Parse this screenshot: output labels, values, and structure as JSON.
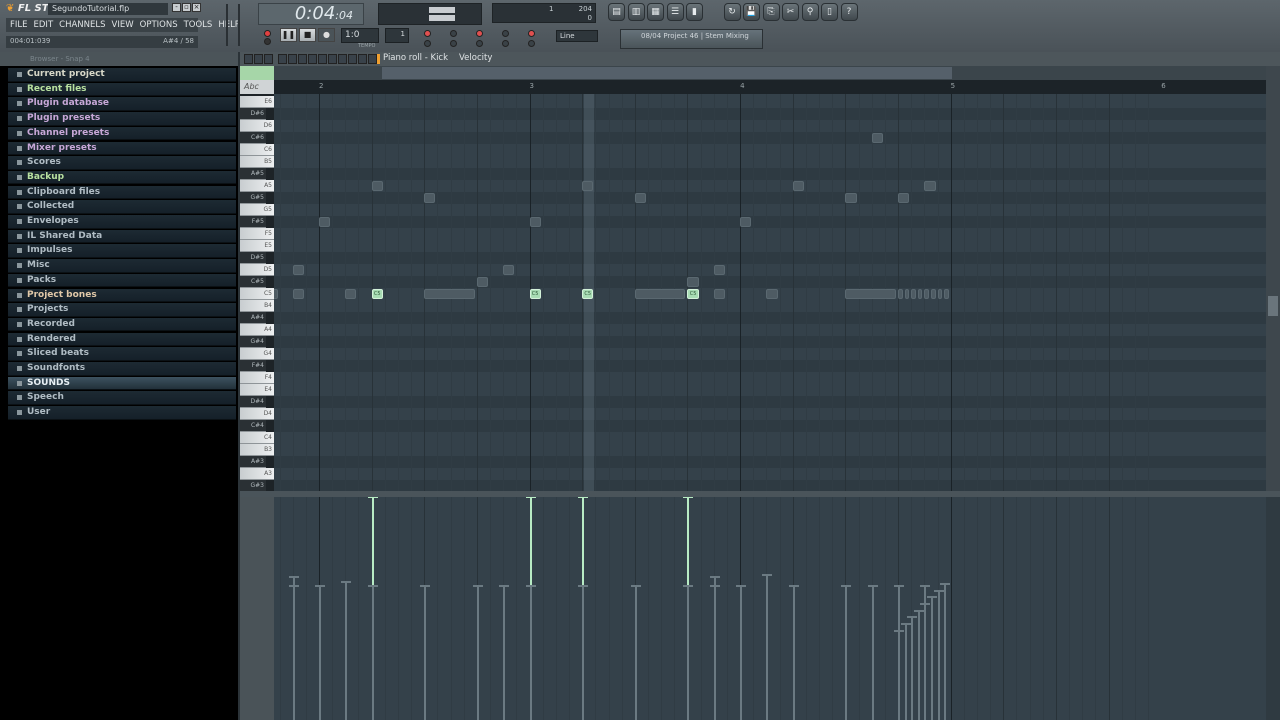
{
  "app": {
    "logo": "FL STUDIO",
    "file_name": "SegundoTutorial.flp",
    "menu": [
      "FILE",
      "EDIT",
      "CHANNELS",
      "VIEW",
      "OPTIONS",
      "TOOLS",
      "HELP"
    ],
    "hint_left": "004:01:039",
    "hint_right": "A#4 / 58"
  },
  "transport": {
    "time_main": "0:04",
    "time_sub": "04",
    "pattern": "1",
    "tempo_label": "TEMPO",
    "monitor_value": "1",
    "cpu_value": "204",
    "poly_value": "0",
    "snap": "Line",
    "project_label": "08/04 Project 46 | Stem Mixing"
  },
  "browser": {
    "header": "Browser - Snap 4",
    "items": [
      {
        "label": "Current project",
        "color": "#d8d8c8"
      },
      {
        "label": "Recent files",
        "color": "#b8e0a0"
      },
      {
        "label": "Plugin database",
        "color": "#c8a8d8"
      },
      {
        "label": "Plugin presets",
        "color": "#c8a8d8"
      },
      {
        "label": "Channel presets",
        "color": "#c8a8d8"
      },
      {
        "label": "Mixer presets",
        "color": "#c8a8d8"
      },
      {
        "label": "Scores",
        "color": "#b0bcc4"
      },
      {
        "label": "Backup",
        "color": "#b8e0a0"
      },
      {
        "label": "Clipboard files",
        "color": "#b0bcc4"
      },
      {
        "label": "Collected",
        "color": "#b0bcc4"
      },
      {
        "label": "Envelopes",
        "color": "#b0bcc4"
      },
      {
        "label": "IL Shared Data",
        "color": "#b0bcc4"
      },
      {
        "label": "Impulses",
        "color": "#b0bcc4"
      },
      {
        "label": "Misc",
        "color": "#b0bcc4"
      },
      {
        "label": "Packs",
        "color": "#b0bcc4"
      },
      {
        "label": "Project bones",
        "color": "#e0c8a8"
      },
      {
        "label": "Projects",
        "color": "#b0bcc4"
      },
      {
        "label": "Recorded",
        "color": "#b0bcc4"
      },
      {
        "label": "Rendered",
        "color": "#b0bcc4"
      },
      {
        "label": "Sliced beats",
        "color": "#b0bcc4"
      },
      {
        "label": "Soundfonts",
        "color": "#b0bcc4"
      },
      {
        "label": "SOUNDS",
        "color": "#e8f0f4",
        "active": true
      },
      {
        "label": "Speech",
        "color": "#b0bcc4"
      },
      {
        "label": "User",
        "color": "#b0bcc4"
      }
    ]
  },
  "piano_roll": {
    "title": "Piano roll - Kick",
    "target": "Velocity",
    "ruler_bars": [
      "2",
      "3",
      "4",
      "5",
      "6"
    ],
    "keys": [
      "E6",
      "D#6",
      "D6",
      "C#6",
      "C6",
      "B5",
      "A#5",
      "A5",
      "G#5",
      "G5",
      "F#5",
      "F5",
      "E5",
      "D#5",
      "D5",
      "C#5",
      "C5",
      "B4",
      "A#4",
      "A4",
      "G#4",
      "G4",
      "F#4",
      "F4",
      "E4",
      "D#4",
      "D4",
      "C#4",
      "C4",
      "B3",
      "A#3",
      "A3",
      "G#3"
    ],
    "notes": [
      {
        "pitch": "C5",
        "step": 12,
        "len": 1,
        "vel": 0.62
      },
      {
        "pitch": "C5",
        "step": 14,
        "len": 1,
        "vel": 0.64
      },
      {
        "pitch": "D5",
        "step": 14,
        "len": 1,
        "vel": 0.6
      },
      {
        "pitch": "F#5",
        "step": 16,
        "len": 1,
        "vel": 0.6
      },
      {
        "pitch": "C5",
        "step": 18,
        "len": 1,
        "vel": 0.62
      },
      {
        "pitch": "C5",
        "step": 20,
        "len": 1,
        "vel": 1,
        "sel": true
      },
      {
        "pitch": "A5",
        "step": 20,
        "len": 1,
        "vel": 0.6
      },
      {
        "pitch": "C5",
        "step": 24,
        "len": 4,
        "vel": 0.6
      },
      {
        "pitch": "G#5",
        "step": 24,
        "len": 1,
        "vel": 0.6
      },
      {
        "pitch": "C#5",
        "step": 28,
        "len": 1,
        "vel": 0.6
      },
      {
        "pitch": "D5",
        "step": 30,
        "len": 1,
        "vel": 0.6
      },
      {
        "pitch": "C5",
        "step": 32,
        "len": 1,
        "vel": 1,
        "sel": true
      },
      {
        "pitch": "F#5",
        "step": 32,
        "len": 1,
        "vel": 0.6
      },
      {
        "pitch": "C5",
        "step": 36,
        "len": 1,
        "vel": 1,
        "sel": true
      },
      {
        "pitch": "A5",
        "step": 36,
        "len": 1,
        "vel": 0.6
      },
      {
        "pitch": "C5",
        "step": 40,
        "len": 4,
        "vel": 0.6
      },
      {
        "pitch": "G#5",
        "step": 40,
        "len": 1,
        "vel": 0.6
      },
      {
        "pitch": "C5",
        "step": 44,
        "len": 1,
        "vel": 1,
        "sel": true
      },
      {
        "pitch": "C#5",
        "step": 44,
        "len": 1,
        "vel": 0.6
      },
      {
        "pitch": "C5",
        "step": 46,
        "len": 1,
        "vel": 0.64
      },
      {
        "pitch": "D5",
        "step": 46,
        "len": 1,
        "vel": 0.6
      },
      {
        "pitch": "F#5",
        "step": 48,
        "len": 1,
        "vel": 0.6
      },
      {
        "pitch": "C5",
        "step": 50,
        "len": 1,
        "vel": 0.65
      },
      {
        "pitch": "A5",
        "step": 52,
        "len": 1,
        "vel": 0.6
      },
      {
        "pitch": "C5",
        "step": 56,
        "len": 4,
        "vel": 0.6
      },
      {
        "pitch": "G#5",
        "step": 56,
        "len": 1,
        "vel": 0.6
      },
      {
        "pitch": "C#6",
        "step": 58,
        "len": 1,
        "vel": 0.6
      },
      {
        "pitch": "G#5",
        "step": 60,
        "len": 1,
        "vel": 0.6
      },
      {
        "pitch": "A5",
        "step": 62,
        "len": 1,
        "vel": 0.6
      },
      {
        "pitch": "C5",
        "step": 60,
        "len": 0.5,
        "vel": 0.4
      },
      {
        "pitch": "C5",
        "step": 60.5,
        "len": 0.5,
        "vel": 0.43
      },
      {
        "pitch": "C5",
        "step": 61,
        "len": 0.5,
        "vel": 0.46
      },
      {
        "pitch": "C5",
        "step": 61.5,
        "len": 0.5,
        "vel": 0.49
      },
      {
        "pitch": "C5",
        "step": 62,
        "len": 0.5,
        "vel": 0.52
      },
      {
        "pitch": "C5",
        "step": 62.5,
        "len": 0.5,
        "vel": 0.55
      },
      {
        "pitch": "C5",
        "step": 63,
        "len": 0.5,
        "vel": 0.58
      },
      {
        "pitch": "C5",
        "step": 63.5,
        "len": 0.5,
        "vel": 0.61
      }
    ]
  },
  "colors": {
    "accent": "#f0a030",
    "selected_note": "#a8dcb4",
    "note": "#4e5b63"
  }
}
